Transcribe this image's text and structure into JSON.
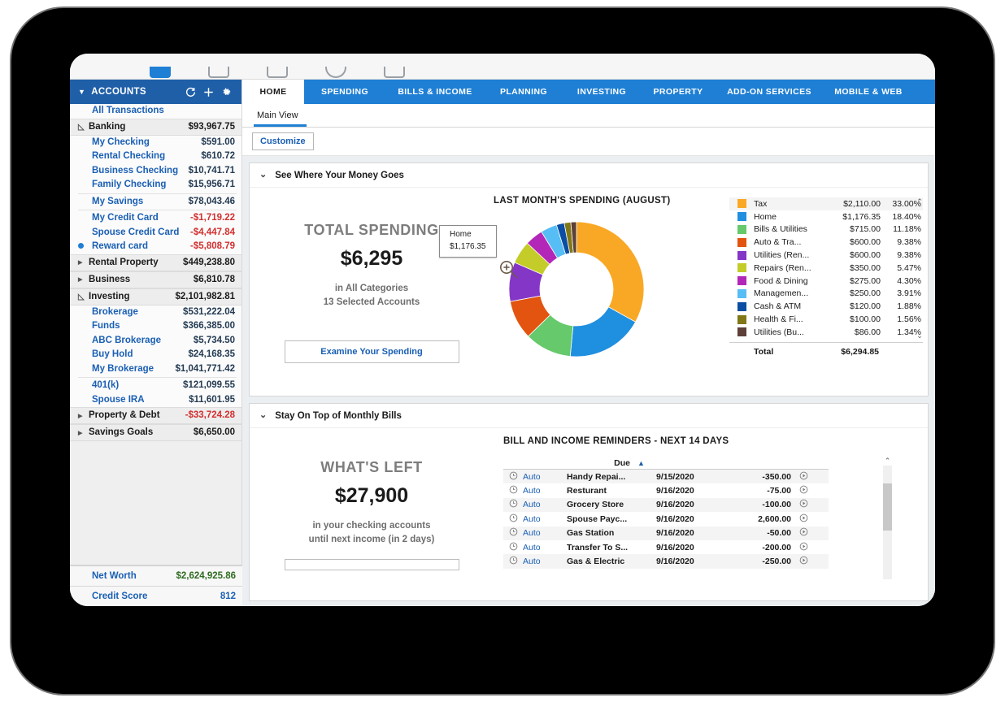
{
  "toolbar": {
    "icons": [
      "toolbar-icon-1",
      "toolbar-icon-2",
      "toolbar-icon-3",
      "toolbar-icon-4",
      "toolbar-icon-5"
    ]
  },
  "sidebar": {
    "header": {
      "title": "ACCOUNTS",
      "refresh": "⟳",
      "add": "+",
      "settings": "⚙"
    },
    "all_transactions": "All Transactions",
    "groups": [
      {
        "name": "Banking",
        "amount": "$93,967.75",
        "expanded": true,
        "negative": false,
        "accounts": [
          {
            "name": "My Checking",
            "amount": "$591.00",
            "negative": false,
            "selected": false
          },
          {
            "name": "Rental Checking",
            "amount": "$610.72",
            "negative": false,
            "selected": false
          },
          {
            "name": "Business Checking",
            "amount": "$10,741.71",
            "negative": false,
            "selected": false
          },
          {
            "name": "Family Checking",
            "amount": "$15,956.71",
            "negative": false,
            "selected": false
          },
          {
            "name": "My Savings",
            "amount": "$78,043.46",
            "negative": false,
            "selected": false,
            "sep_before": true
          },
          {
            "name": "My Credit Card",
            "amount": "-$1,719.22",
            "negative": true,
            "selected": false,
            "sep_before": true
          },
          {
            "name": "Spouse Credit Card",
            "amount": "-$4,447.84",
            "negative": true,
            "selected": false
          },
          {
            "name": "Reward card",
            "amount": "-$5,808.79",
            "negative": true,
            "selected": true
          }
        ]
      },
      {
        "name": "Rental Property",
        "amount": "$449,238.80",
        "expanded": false,
        "negative": false,
        "accounts": []
      },
      {
        "name": "Business",
        "amount": "$6,810.78",
        "expanded": false,
        "negative": false,
        "accounts": []
      },
      {
        "name": "Investing",
        "amount": "$2,101,982.81",
        "expanded": true,
        "negative": false,
        "accounts": [
          {
            "name": "Brokerage",
            "amount": "$531,222.04",
            "negative": false,
            "selected": false
          },
          {
            "name": "Funds",
            "amount": "$366,385.00",
            "negative": false,
            "selected": false
          },
          {
            "name": "ABC Brokerage",
            "amount": "$5,734.50",
            "negative": false,
            "selected": false
          },
          {
            "name": "Buy Hold",
            "amount": "$24,168.35",
            "negative": false,
            "selected": false
          },
          {
            "name": "My Brokerage",
            "amount": "$1,041,771.42",
            "negative": false,
            "selected": false
          },
          {
            "name": "401(k)",
            "amount": "$121,099.55",
            "negative": false,
            "selected": false,
            "sep_before": true
          },
          {
            "name": "Spouse IRA",
            "amount": "$11,601.95",
            "negative": false,
            "selected": false
          }
        ]
      },
      {
        "name": "Property & Debt",
        "amount": "-$33,724.28",
        "expanded": false,
        "negative": true,
        "accounts": []
      },
      {
        "name": "Savings Goals",
        "amount": "$6,650.00",
        "expanded": false,
        "negative": false,
        "accounts": []
      }
    ],
    "footer": [
      {
        "label": "Net Worth",
        "value": "$2,624,925.86",
        "color": "green"
      },
      {
        "label": "Credit Score",
        "value": "812",
        "color": "blue"
      }
    ]
  },
  "tabs": [
    {
      "label": "HOME",
      "active": true
    },
    {
      "label": "SPENDING",
      "active": false
    },
    {
      "label": "BILLS & INCOME",
      "active": false
    },
    {
      "label": "PLANNING",
      "active": false
    },
    {
      "label": "INVESTING",
      "active": false
    },
    {
      "label": "PROPERTY",
      "active": false
    },
    {
      "label": "ADD-ON SERVICES",
      "active": false
    },
    {
      "label": "MOBILE & WEB",
      "active": false
    }
  ],
  "subtab": {
    "label": "Main View"
  },
  "customize_button": "Customize",
  "spending_card": {
    "header": "See Where Your Money Goes",
    "total_label": "TOTAL SPENDING",
    "total_amount": "$6,295",
    "sub_line_1": "in All Categories",
    "sub_line_2": "13 Selected Accounts",
    "examine_button": "Examine Your Spending",
    "tooltip": {
      "name": "Home",
      "amount": "$1,176.35"
    },
    "total_row_label": "Total",
    "total_row_amount": "$6,294.85"
  },
  "chart_data": {
    "type": "pie",
    "title": "LAST MONTH'S SPENDING (AUGUST)",
    "subtitle": "",
    "xlabel": "",
    "ylabel": "",
    "legend_position": "right",
    "total": 6294.85,
    "total_formatted": "$6,294.85",
    "categories": [
      "Tax",
      "Home",
      "Bills & Utilities",
      "Auto & Tra...",
      "Utilities (Ren...",
      "Repairs (Ren...",
      "Food & Dining",
      "Managemen...",
      "Cash & ATM",
      "Health & Fi...",
      "Utilities (Bu..."
    ],
    "values": [
      2110.0,
      1176.35,
      715.0,
      600.0,
      600.0,
      350.0,
      275.0,
      250.0,
      120.0,
      100.0,
      86.0
    ],
    "values_formatted": [
      "$2,110.00",
      "$1,176.35",
      "$715.00",
      "$600.00",
      "$600.00",
      "$350.00",
      "$275.00",
      "$250.00",
      "$120.00",
      "$100.00",
      "$86.00"
    ],
    "percents": [
      33.0,
      18.4,
      11.18,
      9.38,
      9.38,
      5.47,
      4.3,
      3.91,
      1.88,
      1.56,
      1.34
    ],
    "percents_formatted": [
      "33.00%",
      "18.40%",
      "11.18%",
      "9.38%",
      "9.38%",
      "5.47%",
      "4.30%",
      "3.91%",
      "1.88%",
      "1.56%",
      "1.34%"
    ],
    "colors": [
      "#f9a825",
      "#1f8fe0",
      "#66c96b",
      "#e2540f",
      "#8437c6",
      "#c3cc28",
      "#b327b8",
      "#56bdf5",
      "#0b4da2",
      "#827717",
      "#5d4037"
    ]
  },
  "bills_card": {
    "header": "Stay On Top of Monthly Bills",
    "whats_left_label": "WHAT'S LEFT",
    "whats_left_amount": "$27,900",
    "sub_line_1": "in your checking accounts",
    "sub_line_2": "until next income (in 2 days)",
    "table_title": "BILL AND INCOME REMINDERS - NEXT 14 DAYS",
    "due_header": "Due",
    "sort_arrow": "▲",
    "rows": [
      {
        "status": "Auto",
        "payee": "Handy Repai...",
        "due": "9/15/2020",
        "amount": "-350.00"
      },
      {
        "status": "Auto",
        "payee": "Resturant",
        "due": "9/16/2020",
        "amount": "-75.00"
      },
      {
        "status": "Auto",
        "payee": "Grocery Store",
        "due": "9/16/2020",
        "amount": "-100.00"
      },
      {
        "status": "Auto",
        "payee": "Spouse Payc...",
        "due": "9/16/2020",
        "amount": "2,600.00"
      },
      {
        "status": "Auto",
        "payee": "Gas Station",
        "due": "9/16/2020",
        "amount": "-50.00"
      },
      {
        "status": "Auto",
        "payee": "Transfer To S...",
        "due": "9/16/2020",
        "amount": "-200.00"
      },
      {
        "status": "Auto",
        "payee": "Gas & Electric",
        "due": "9/16/2020",
        "amount": "-250.00"
      }
    ]
  },
  "colors": {
    "tab_blue": "#1f7fd4",
    "sidebar_header_blue": "#1f5fa8",
    "link_blue": "#1a5fb4",
    "negative_red": "#d32f2f",
    "positive_green": "#2e6b1f"
  }
}
